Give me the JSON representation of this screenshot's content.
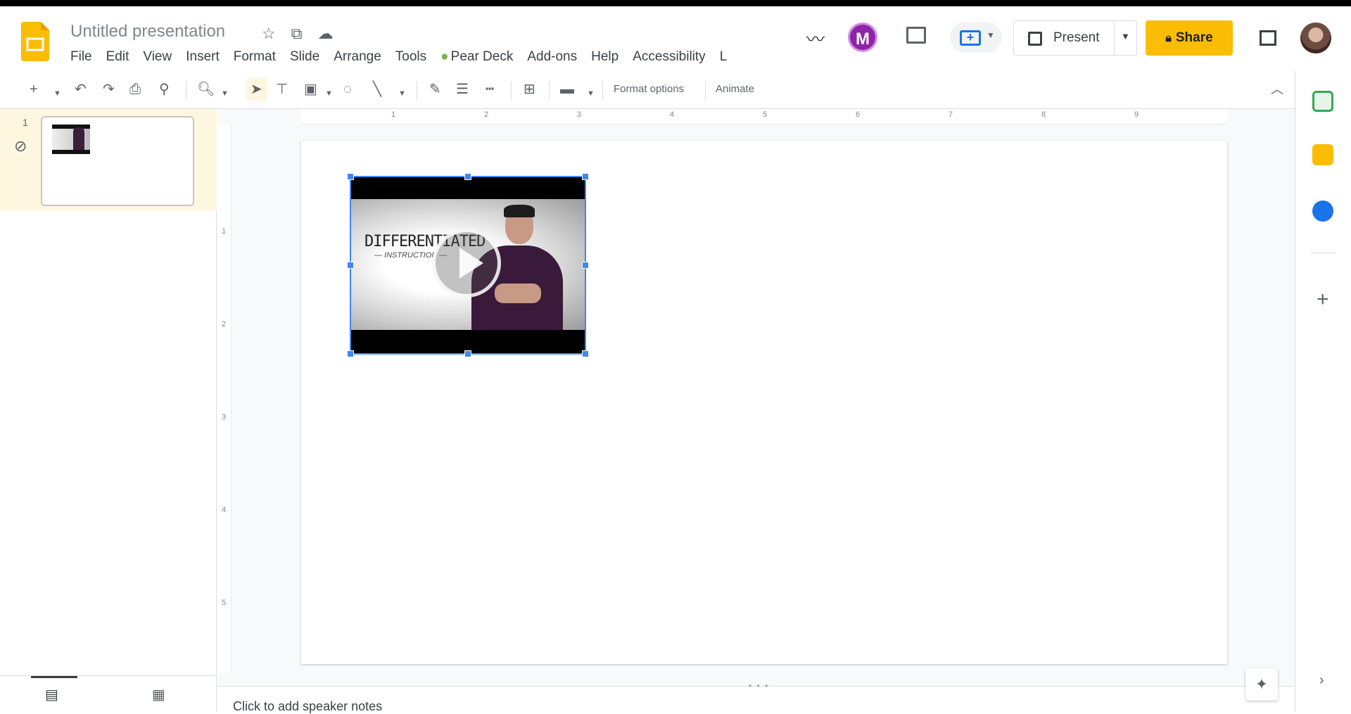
{
  "app": {
    "title": "Untitled presentation",
    "menu": [
      "File",
      "Edit",
      "View",
      "Insert",
      "Format",
      "Slide",
      "Arrange",
      "Tools",
      "Pear Deck",
      "Add-ons",
      "Help",
      "Accessibility",
      "L"
    ],
    "brand_color": "#fbbc04"
  },
  "header": {
    "present_label": "Present",
    "share_label": "Share",
    "addon_avatar_letter": "M"
  },
  "toolbar": {
    "format_options_label": "Format options",
    "animate_label": "Animate"
  },
  "filmstrip": {
    "slides": [
      {
        "number": "1"
      }
    ]
  },
  "ruler": {
    "h_ticks": [
      "1",
      "2",
      "3",
      "4",
      "5",
      "6",
      "7",
      "8",
      "9"
    ],
    "v_ticks": [
      "1",
      "2",
      "3",
      "4",
      "5"
    ]
  },
  "video": {
    "title": "DIFFERENTIATED",
    "subtitle": "— INSTRUCTION —"
  },
  "notes": {
    "placeholder": "Click to add speaker notes"
  },
  "icons": {
    "star": "star-icon",
    "move": "move-to-folder-icon",
    "cloud": "cloud-saved-icon",
    "activity": "activity-dashboard-icon",
    "comments": "comments-icon",
    "meet": "meet-icon"
  }
}
